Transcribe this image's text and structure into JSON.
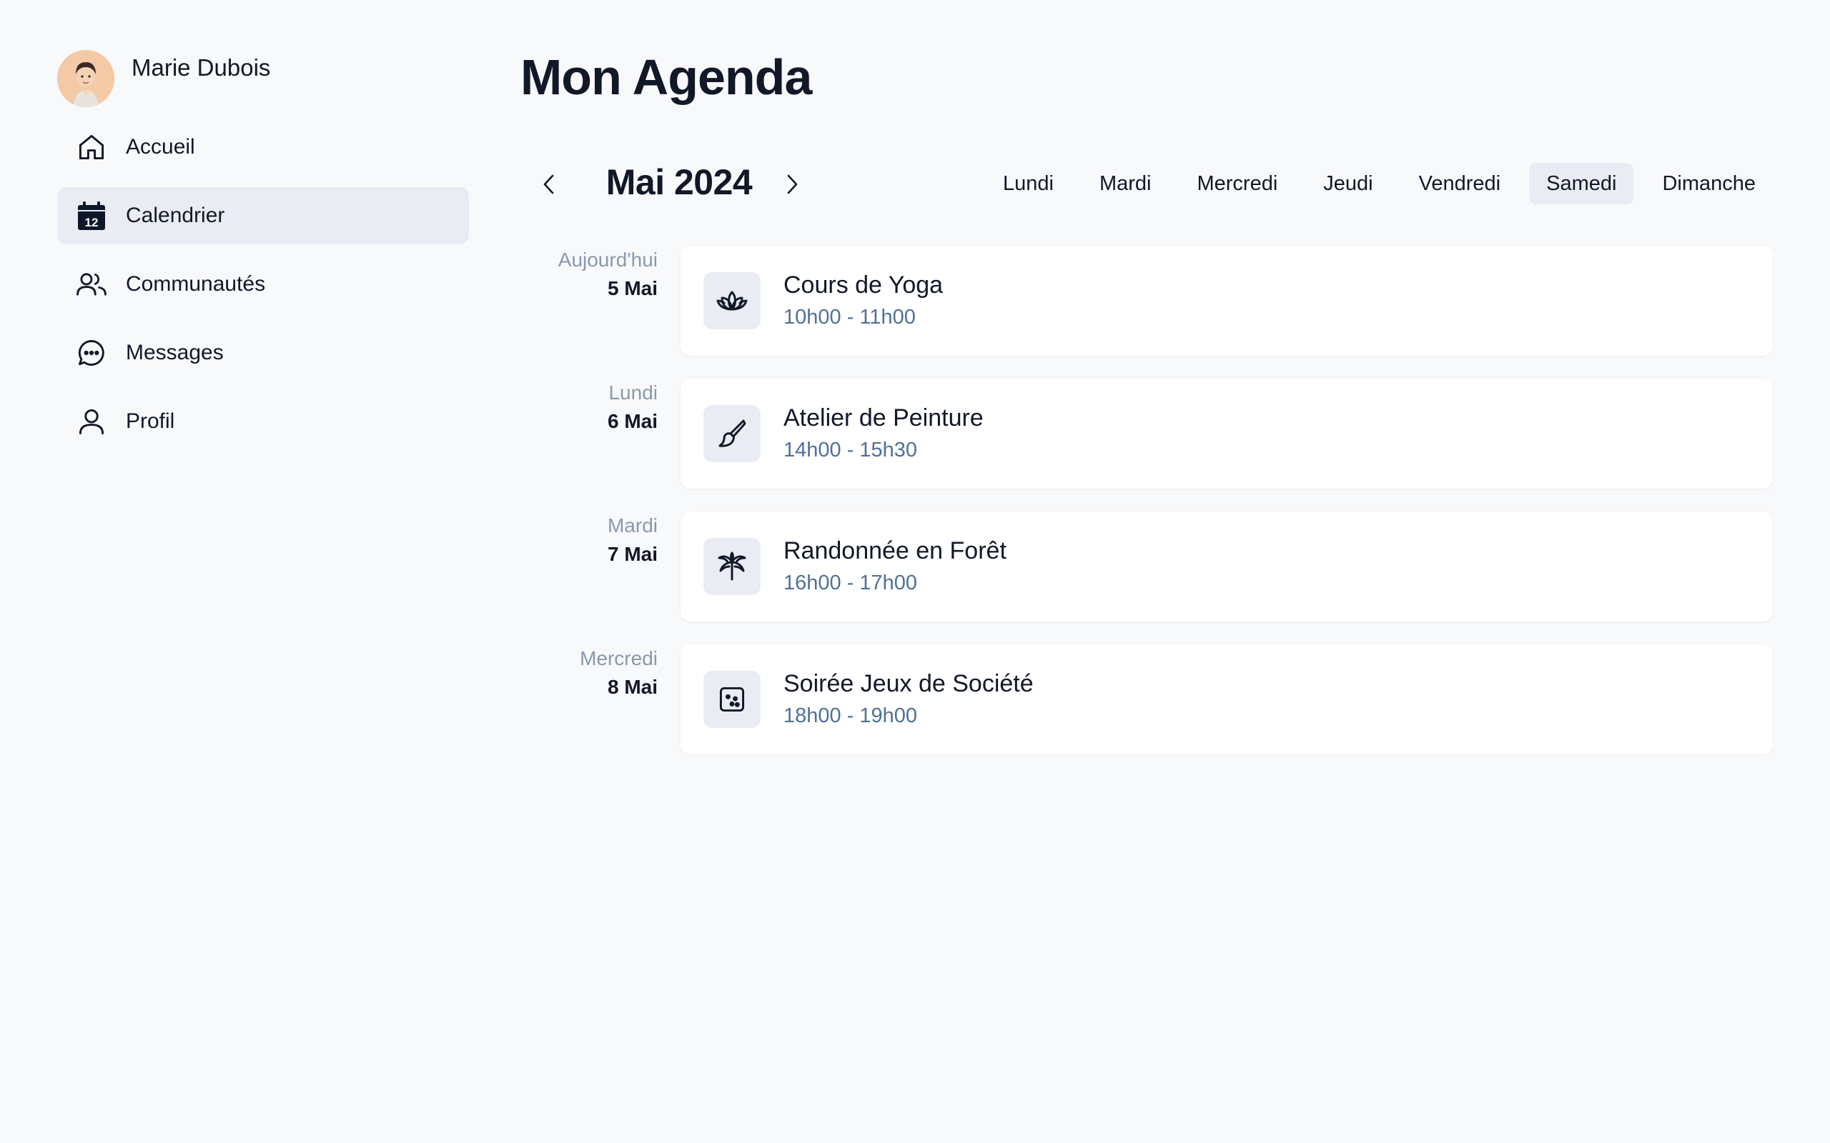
{
  "user": {
    "name": "Marie Dubois"
  },
  "sidebar": {
    "items": [
      {
        "label": "Accueil",
        "icon": "home-icon",
        "active": false
      },
      {
        "label": "Calendrier",
        "icon": "calendar-icon",
        "active": true,
        "icon_text": "12"
      },
      {
        "label": "Communautés",
        "icon": "users-icon",
        "active": false
      },
      {
        "label": "Messages",
        "icon": "chat-icon",
        "active": false
      },
      {
        "label": "Profil",
        "icon": "user-icon",
        "active": false
      }
    ]
  },
  "page": {
    "title": "Mon Agenda"
  },
  "calendar": {
    "month_label": "Mai 2024",
    "prev_icon": "chevron-left-icon",
    "next_icon": "chevron-right-icon",
    "days": [
      "Lundi",
      "Mardi",
      "Mercredi",
      "Jeudi",
      "Vendredi",
      "Samedi",
      "Dimanche"
    ],
    "active_day": "Samedi"
  },
  "events": [
    {
      "day": "Aujourd'hui",
      "date": "5 Mai",
      "title": "Cours de Yoga",
      "time": "10h00 - 11h00",
      "icon": "lotus-icon"
    },
    {
      "day": "Lundi",
      "date": "6 Mai",
      "title": "Atelier de Peinture",
      "time": "14h00 - 15h30",
      "icon": "paintbrush-icon"
    },
    {
      "day": "Mardi",
      "date": "7 Mai",
      "title": "Randonnée en Forêt",
      "time": "16h00 - 17h00",
      "icon": "palm-tree-icon"
    },
    {
      "day": "Mercredi",
      "date": "8 Mai",
      "title": "Soirée Jeux de Société",
      "time": "18h00 - 19h00",
      "icon": "dice-icon"
    }
  ],
  "colors": {
    "background": "#f8f9fb",
    "active_bg": "#e9edf3",
    "time_text": "#4f7196",
    "day_text": "#8a99ac"
  }
}
